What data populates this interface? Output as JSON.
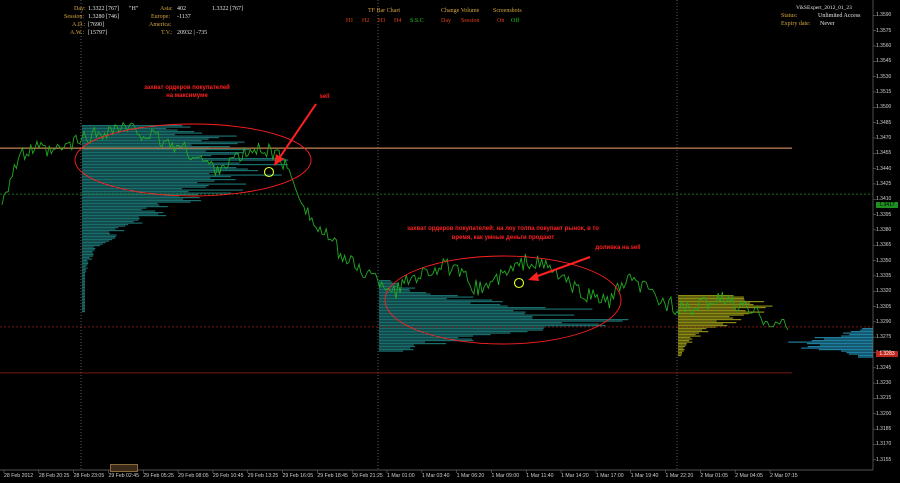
{
  "colors": {
    "background": "#000000",
    "price_line": "#22aa22",
    "profile_teal": "#1a6d6d",
    "profile_olive": "#8a8a14",
    "annotation_red": "#ff2020",
    "level_orange": "#f5a36a",
    "level_red": "#c0281c",
    "level_green": "#1f8f1f"
  },
  "info_panel": {
    "day_label": "Day:",
    "day_value": "1.3322 [767]",
    "day_flag": "\"H\"",
    "session_label": "Session:",
    "session_value": "1.3280 [746]",
    "ad_label": "A.D.:",
    "ad_value": "[7690]",
    "aw_label": "A.W.:",
    "aw_value": "[15797]",
    "asia_label": "Asia:",
    "asia_value": "402",
    "asia_value2": "1.3322 [767]",
    "europe_label": "Europe:",
    "europe_value": "-1137",
    "america_label": "America:",
    "tv_label": "T.V.:",
    "tv_value": "20932 | -735"
  },
  "buttons": {
    "tf_bar_chart": "TF Bar Chart",
    "h1": "H1",
    "h2": "H2",
    "h3": "H3",
    "h4": "H4",
    "session_btn": "S.S.C",
    "change_volume": "Change Volume",
    "day": "Day",
    "session": "Session",
    "screenshots": "Screenshots",
    "on": "On",
    "off": "Off"
  },
  "license": {
    "version": "VikSExpert_2012_01_23",
    "status_label": "Status:",
    "status_value": "Unlimited Access",
    "expiry_label": "Expiry date:",
    "expiry_value": "Never"
  },
  "annotations": {
    "a1_line1": "захват ордеров покупателей",
    "a1_line2": "на максимуме",
    "a1_sell": "sell",
    "a2_line1": "захват ордеров покупателей: на лоу толпа покупает рынок, в то",
    "a2_line2": "время, как умные деньги продают",
    "a2_sell": "доливка на sell"
  },
  "chart_data": {
    "type": "line",
    "title": "",
    "xlabel": "",
    "ylabel": "",
    "ylim": [
      1.3145,
      1.3605
    ],
    "y_ticks": [
      "1.3590",
      "1.3575",
      "1.3560",
      "1.3545",
      "1.3530",
      "1.3515",
      "1.3500",
      "1.3485",
      "1.3470",
      "1.3455",
      "1.3440",
      "1.3425",
      "1.3410",
      "1.3395",
      "1.3380",
      "1.3365",
      "1.3350",
      "1.3335",
      "1.3320",
      "1.3305",
      "1.3290",
      "1.3275",
      "1.3260",
      "1.3245",
      "1.3230",
      "1.3215",
      "1.3200",
      "1.3185",
      "1.3170",
      "1.3155"
    ],
    "x_ticks": [
      "28 Feb 2012",
      "28 Feb 20:25",
      "28 Feb 23:05",
      "29 Feb 02:45",
      "29 Feb 05:25",
      "29 Feb 08:05",
      "29 Feb 10:45",
      "29 Feb 13:25",
      "29 Feb 16:05",
      "29 Feb 18:45",
      "29 Feb 21:25",
      "1 Mar 01:00",
      "1 Mar 03:40",
      "1 Mar 06:20",
      "1 Mar 09:00",
      "1 Mar 11:40",
      "1 Mar 14:20",
      "1 Mar 17:00",
      "1 Mar 19:40",
      "1 Mar 22:20",
      "2 Mar 01:05",
      "2 Mar 04:05",
      "2 Mar 07:15"
    ],
    "series": [
      {
        "values": [
          1.341,
          1.345,
          1.346,
          1.3455,
          1.3462,
          1.347,
          1.3475,
          1.348,
          1.3478,
          1.3472,
          1.3465,
          1.346,
          1.345,
          1.344,
          1.3448,
          1.3455,
          1.346,
          1.345,
          1.342,
          1.3385,
          1.337,
          1.335,
          1.334,
          1.333,
          1.332,
          1.3335,
          1.334,
          1.3345,
          1.3335,
          1.3322,
          1.333,
          1.334,
          1.335,
          1.3345,
          1.3335,
          1.332,
          1.3315,
          1.331,
          1.333,
          1.3325,
          1.3312,
          1.3305,
          1.33,
          1.331,
          1.3312,
          1.3305,
          1.3298,
          1.329,
          1.3285
        ]
      }
    ],
    "levels": [
      {
        "price": 1.346,
        "color": "orange"
      },
      {
        "price": 1.3285,
        "color": "red"
      },
      {
        "price": 1.324,
        "color": "red"
      },
      {
        "price": 1.3415,
        "color": "green"
      }
    ],
    "price_labels": [
      {
        "text": "1.3417",
        "color": "green"
      },
      {
        "text": "1.3283",
        "color": "red"
      }
    ],
    "grid": false
  }
}
